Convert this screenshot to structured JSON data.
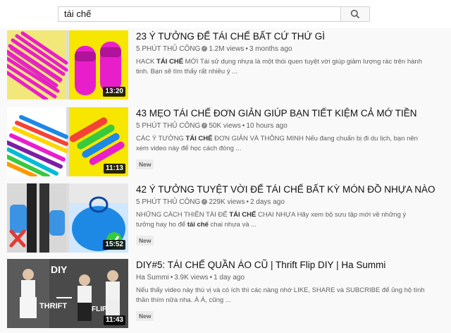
{
  "search": {
    "query": "tái chế"
  },
  "results": [
    {
      "title": "23 Ý TƯỞNG ĐỂ TÁI CHẾ BẤT CỨ THỨ GÌ",
      "channel": "5 PHÚT THỦ CÔNG",
      "views": "1.2M views",
      "age": "3 months ago",
      "desc_pre": "HACK ",
      "desc_bold": "TÁI CHẾ",
      "desc_post": " MỚI Tái sử dụng nhựa là một thói quen tuyệt vời giúp giảm lượng rác trên hành tinh. Bạn sẽ tìm thấy rất nhiều ý ...",
      "duration": "13:20",
      "badge": ""
    },
    {
      "title": "43 MẸO TÁI CHẾ ĐƠN GIẢN GIÚP BẠN TIẾT KIỆM CẢ MỚ TIỀN",
      "channel": "5 PHÚT THỦ CÔNG",
      "views": "50K views",
      "age": "10 hours ago",
      "desc_pre": "CÁC Ý TƯỞNG ",
      "desc_bold": "TÁI CHẾ",
      "desc_post": " ĐƠN GIẢN VÀ THÔNG MINH Nếu đang chuẩn bị đi du lịch, bạn nên xem video này để học cách đóng ...",
      "duration": "11:13",
      "badge": "New"
    },
    {
      "title": "42 Ý TƯỞNG TUYỆT VỜI ĐỂ TÁI CHẾ BẤT KỲ MÓN ĐỒ NHỰA NÀO",
      "channel": "5 PHÚT THỦ CÔNG",
      "views": "229K views",
      "age": "2 days ago",
      "desc_pre": "NHỮNG CÁCH THIÊN TÀI ĐỂ ",
      "desc_bold": "TÁI CHẾ",
      "desc_post": " CHAI NHỰA Hãy xem bộ sưu tập mới về những ý tưởng hay ho để ",
      "desc_bold2": "tái chế",
      "desc_post2": " chai nhựa và ...",
      "duration": "15:52",
      "badge": "New"
    },
    {
      "title": "DIY#5: TÁI CHẾ QUẦN ÁO CŨ | Thrift Flip DIY | Ha Summi",
      "channel": "Ha Summi",
      "views": "3.9K views",
      "age": "1 day ago",
      "desc_pre": "Nếu thấy video này thú vị và có ích thì các nàng nhớ LIKE, SHARE và SUBCRIBE để ủng hộ tình thần thím nữa nha. À Á, cũng ...",
      "desc_bold": "",
      "desc_post": "",
      "duration": "11:43",
      "badge": "New",
      "thumb_text": {
        "diy": "DIY",
        "thrift": "THRIFT",
        "flip": "FLIP"
      }
    }
  ],
  "colors": {
    "magenta": "#e91ecb",
    "yellow": "#f7e600",
    "green": "#38c93e",
    "blue": "#1e88e5"
  }
}
